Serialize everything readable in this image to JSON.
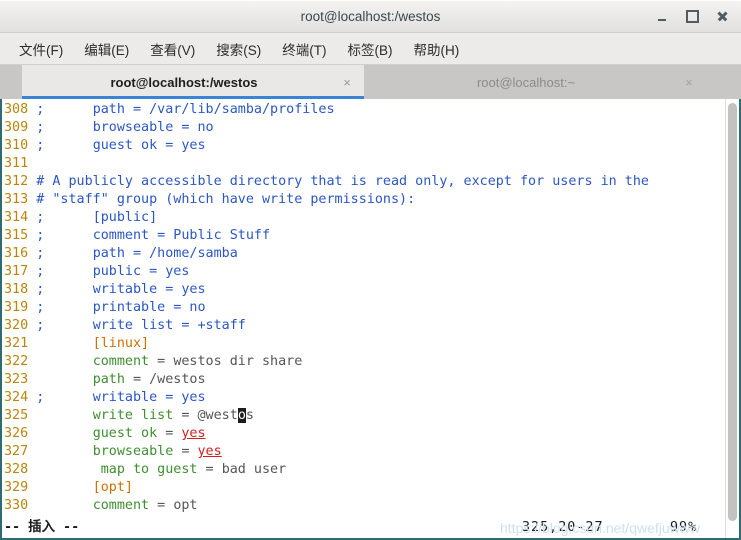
{
  "window": {
    "title": "root@localhost:/westos",
    "controls": {
      "minimize": "–",
      "maximize": "□",
      "close": "×"
    }
  },
  "menubar": {
    "items": [
      {
        "label": "文件(F)"
      },
      {
        "label": "编辑(E)"
      },
      {
        "label": "查看(V)"
      },
      {
        "label": "搜索(S)"
      },
      {
        "label": "终端(T)"
      },
      {
        "label": "标签(B)"
      },
      {
        "label": "帮助(H)"
      }
    ]
  },
  "tabs": [
    {
      "label": "root@localhost:/westos",
      "close": "×",
      "active": true
    },
    {
      "label": "root@localhost:~",
      "close": "×",
      "active": false
    }
  ],
  "editor": {
    "lines": [
      {
        "n": "308",
        "mark": ";",
        "indent": 6,
        "segments": [
          {
            "t": "path = ",
            "c": "blue"
          },
          {
            "t": "/var/lib/samba/profiles",
            "c": "blue"
          }
        ]
      },
      {
        "n": "309",
        "mark": ";",
        "indent": 6,
        "segments": [
          {
            "t": "browseable = no",
            "c": "blue"
          }
        ]
      },
      {
        "n": "310",
        "mark": ";",
        "indent": 6,
        "segments": [
          {
            "t": "guest ok = yes",
            "c": "blue"
          }
        ]
      },
      {
        "n": "311",
        "mark": "",
        "indent": 0,
        "segments": []
      },
      {
        "n": "312",
        "mark": "#",
        "indent": 1,
        "segments": [
          {
            "t": "A publicly accessible directory that is read only, except for users in the",
            "c": "blue"
          }
        ]
      },
      {
        "n": "313",
        "mark": "#",
        "indent": 1,
        "segments": [
          {
            "t": "\"staff\" group (which have write permissions):",
            "c": "blue"
          }
        ]
      },
      {
        "n": "314",
        "mark": ";",
        "indent": 6,
        "segments": [
          {
            "t": "[public]",
            "c": "blue"
          }
        ]
      },
      {
        "n": "315",
        "mark": ";",
        "indent": 6,
        "segments": [
          {
            "t": "comment = Public Stuff",
            "c": "blue"
          }
        ]
      },
      {
        "n": "316",
        "mark": ";",
        "indent": 6,
        "segments": [
          {
            "t": "path = /home/samba",
            "c": "blue"
          }
        ]
      },
      {
        "n": "317",
        "mark": ";",
        "indent": 6,
        "segments": [
          {
            "t": "public = yes",
            "c": "blue"
          }
        ]
      },
      {
        "n": "318",
        "mark": ";",
        "indent": 6,
        "segments": [
          {
            "t": "writable = yes",
            "c": "blue"
          }
        ]
      },
      {
        "n": "319",
        "mark": ";",
        "indent": 6,
        "segments": [
          {
            "t": "printable = no",
            "c": "blue"
          }
        ]
      },
      {
        "n": "320",
        "mark": ";",
        "indent": 6,
        "segments": [
          {
            "t": "write list = +staff",
            "c": "blue"
          }
        ]
      },
      {
        "n": "321",
        "mark": "",
        "indent": 6,
        "segments": [
          {
            "t": "[linux]",
            "c": "orange"
          }
        ]
      },
      {
        "n": "322",
        "mark": "",
        "indent": 6,
        "segments": [
          {
            "t": "comment",
            "c": "green"
          },
          {
            "t": " = ",
            "c": "gray"
          },
          {
            "t": "westos dir share",
            "c": "gray"
          }
        ]
      },
      {
        "n": "323",
        "mark": "",
        "indent": 6,
        "segments": [
          {
            "t": "path",
            "c": "green"
          },
          {
            "t": " = ",
            "c": "gray"
          },
          {
            "t": "/westos",
            "c": "gray"
          }
        ]
      },
      {
        "n": "324",
        "mark": ";",
        "indent": 6,
        "segments": [
          {
            "t": "writable = yes",
            "c": "blue"
          }
        ]
      },
      {
        "n": "325",
        "mark": "",
        "indent": 6,
        "segments": [
          {
            "t": "write list",
            "c": "green"
          },
          {
            "t": " = ",
            "c": "gray"
          },
          {
            "t": "@west",
            "c": "gray"
          },
          {
            "t": "o",
            "c": "cursor"
          },
          {
            "t": "s",
            "c": "gray"
          }
        ]
      },
      {
        "n": "326",
        "mark": "",
        "indent": 6,
        "segments": [
          {
            "t": "guest ok",
            "c": "green"
          },
          {
            "t": " = ",
            "c": "gray"
          },
          {
            "t": "yes",
            "c": "red"
          }
        ]
      },
      {
        "n": "327",
        "mark": "",
        "indent": 6,
        "segments": [
          {
            "t": "browseable",
            "c": "green"
          },
          {
            "t": " = ",
            "c": "gray"
          },
          {
            "t": "yes",
            "c": "red"
          }
        ]
      },
      {
        "n": "328",
        "mark": "",
        "indent": 7,
        "segments": [
          {
            "t": "map to guest",
            "c": "green"
          },
          {
            "t": " = ",
            "c": "gray"
          },
          {
            "t": "bad user",
            "c": "gray"
          }
        ]
      },
      {
        "n": "329",
        "mark": "",
        "indent": 6,
        "segments": [
          {
            "t": "[opt]",
            "c": "orange"
          }
        ]
      },
      {
        "n": "330",
        "mark": "",
        "indent": 6,
        "segments": [
          {
            "t": "comment",
            "c": "green"
          },
          {
            "t": " = ",
            "c": "gray"
          },
          {
            "t": "opt",
            "c": "gray"
          }
        ]
      }
    ],
    "status": {
      "mode": "-- 插入 --",
      "position": "325,20-27",
      "percent": "99%"
    },
    "watermark": "https://blog.csdn.net/qwefjuwww"
  }
}
